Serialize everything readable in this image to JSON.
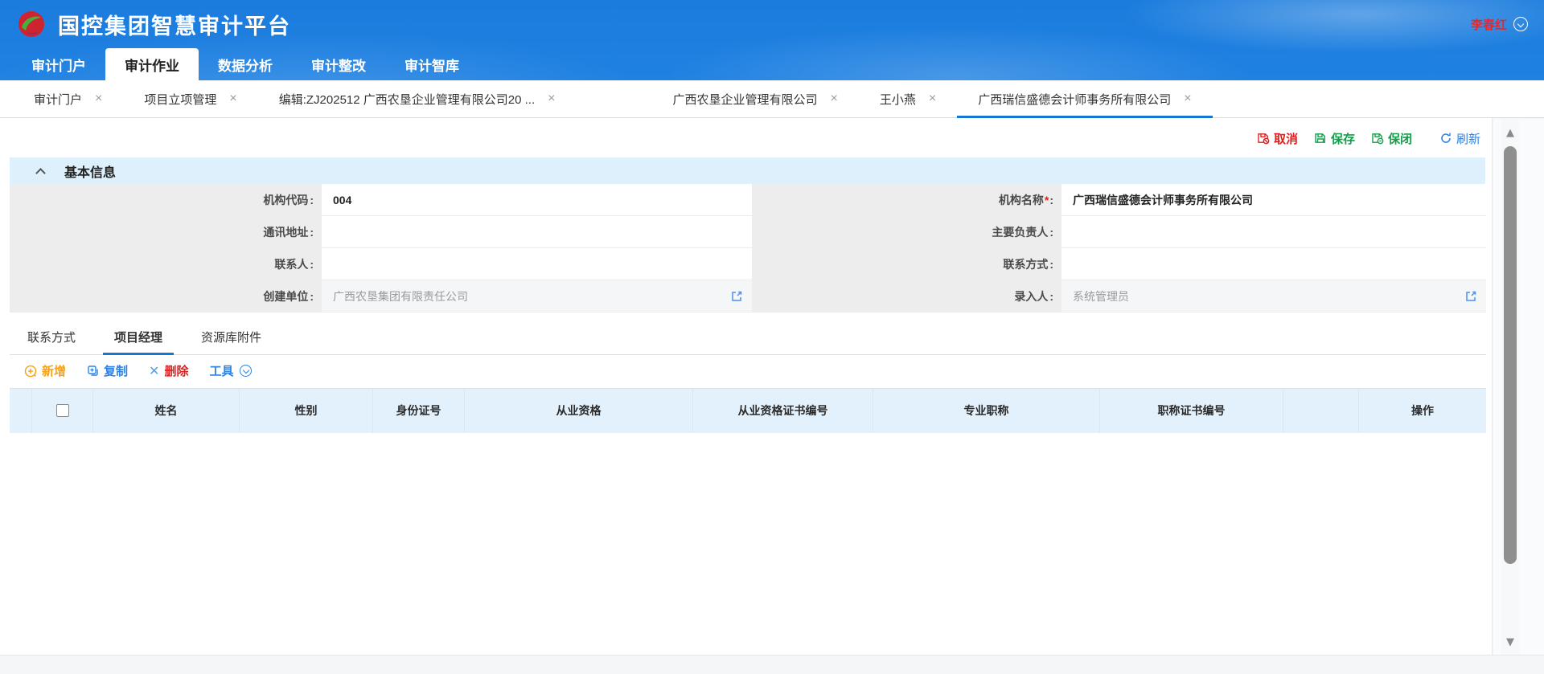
{
  "header": {
    "title": "国控集团智慧审计平台",
    "user": {
      "name": "李春红"
    }
  },
  "nav": {
    "items": [
      {
        "label": "审计门户"
      },
      {
        "label": "审计作业"
      },
      {
        "label": "数据分析"
      },
      {
        "label": "审计整改"
      },
      {
        "label": "审计智库"
      }
    ]
  },
  "tabbar": {
    "close_glyph": "×",
    "tabs": [
      {
        "label": "审计门户"
      },
      {
        "label": "项目立项管理"
      },
      {
        "label": "编辑:ZJ202512 广西农垦企业管理有限公司20 ..."
      },
      {
        "label": "广西农垦企业管理有限公司"
      },
      {
        "label": "王小燕"
      },
      {
        "label": "广西瑞信盛德会计师事务所有限公司"
      }
    ]
  },
  "actions": {
    "cancel": "取消",
    "save": "保存",
    "save_close": "保闭",
    "refresh": "刷新"
  },
  "section": {
    "title": "基本信息"
  },
  "form": {
    "colon": ":",
    "rows": [
      {
        "left": {
          "label": "机构代码",
          "star": "",
          "value": "004"
        },
        "right": {
          "label": "机构名称",
          "star": "*",
          "value": "广西瑞信盛德会计师事务所有限公司"
        }
      },
      {
        "left": {
          "label": "通讯地址",
          "star": "",
          "value": ""
        },
        "right": {
          "label": "主要负责人",
          "star": "",
          "value": ""
        }
      },
      {
        "left": {
          "label": "联系人",
          "star": "",
          "value": ""
        },
        "right": {
          "label": "联系方式",
          "star": "",
          "value": ""
        }
      },
      {
        "left": {
          "label": "创建单位",
          "star": "",
          "value": "广西农垦集团有限责任公司"
        },
        "right": {
          "label": "录入人",
          "star": "",
          "value": "系统管理员"
        }
      }
    ]
  },
  "subtabs": {
    "tabs": [
      {
        "label": "联系方式"
      },
      {
        "label": "项目经理"
      },
      {
        "label": "资源库附件"
      }
    ]
  },
  "toolbar": {
    "add": "新增",
    "copy": "复制",
    "delete": "删除",
    "delete_x": "✕",
    "tools": "工具"
  },
  "table": {
    "columns": [
      "",
      "",
      "姓名",
      "性别",
      "身份证号",
      "从业资格",
      "从业资格证书编号",
      "专业职称",
      "职称证书编号",
      "",
      "操作"
    ]
  },
  "icons": {
    "scroll_up": "▲",
    "scroll_down": "▼"
  },
  "colors": {
    "header_blue": "#1b7cdd",
    "accent_blue": "#1677d2",
    "danger_red": "#e02020",
    "success_green": "#149e4c",
    "warning_orange": "#f5a31d",
    "section_bg": "#ddf0fc",
    "table_header_bg": "#e3f1fc",
    "user_name_red": "#e8262d"
  }
}
